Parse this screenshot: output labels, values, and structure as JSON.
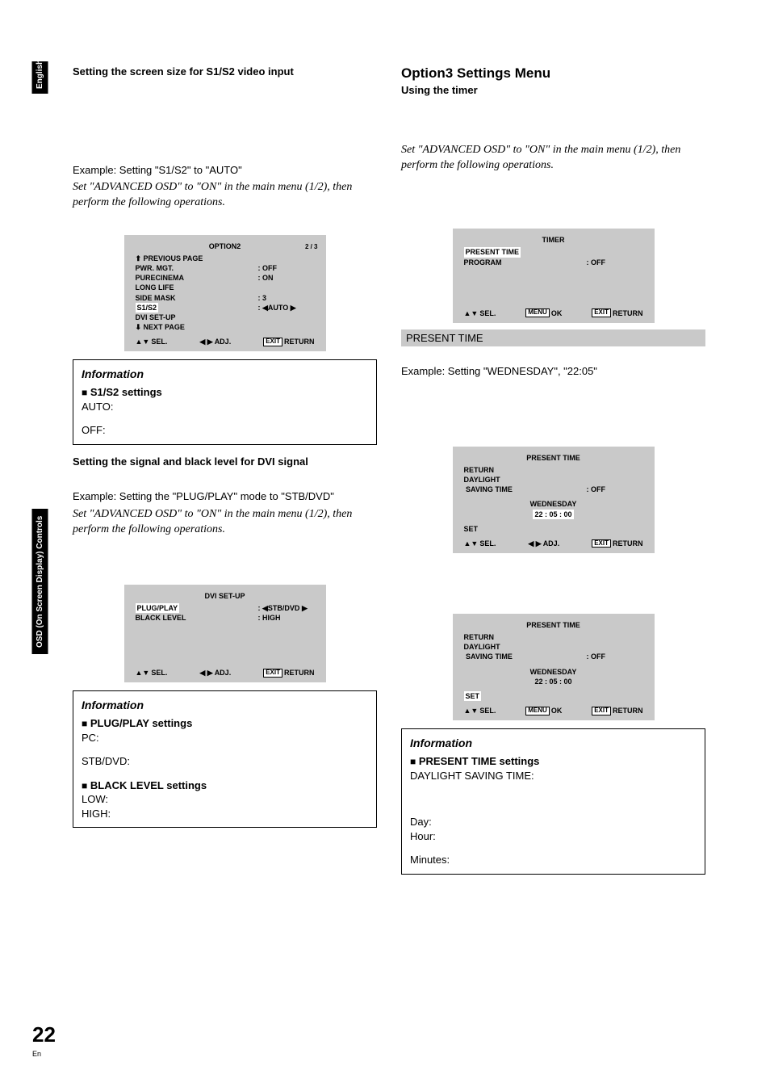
{
  "sidebar": {
    "lang": "English",
    "osd": "OSD (On Screen Display) Controls"
  },
  "page_number": "22",
  "page_lang": "En",
  "left": {
    "h1": "Setting the screen size for S1/S2 video input",
    "example1": "Example: Setting \"S1/S2\" to \"AUTO\"",
    "note1": "Set \"ADVANCED OSD\" to \"ON\" in the main menu (1/2), then perform the following operations.",
    "osd1": {
      "title": "OPTION2",
      "page": "2 / 3",
      "prev": "PREVIOUS PAGE",
      "rows": {
        "pwr": {
          "label": "PWR. MGT.",
          "val": ":   OFF"
        },
        "pure": {
          "label": "PURECINEMA",
          "val": ":   ON"
        },
        "long": {
          "label": "LONG LIFE",
          "val": ""
        },
        "side": {
          "label": "SIDE MASK",
          "val": ":   3"
        },
        "s1s2": {
          "label": "S1/S2",
          "val": "AUTO"
        },
        "dvi": {
          "label": "DVI SET-UP",
          "val": ""
        }
      },
      "next": "NEXT PAGE",
      "footer": {
        "sel": "SEL.",
        "adj": "ADJ.",
        "exit": "EXIT",
        "ret": "RETURN"
      }
    },
    "info1": {
      "title": "Information",
      "sub": "S1/S2 settings",
      "auto": "AUTO:",
      "off": "OFF:"
    },
    "h2": "Setting the signal and black level for DVI signal",
    "example2": "Example: Setting the \"PLUG/PLAY\" mode to \"STB/DVD\"",
    "note2": "Set \"ADVANCED OSD\" to \"ON\" in the main menu (1/2), then perform the following operations.",
    "osd2": {
      "title": "DVI SET-UP",
      "rows": {
        "plug": {
          "label": "PLUG/PLAY",
          "val": "STB/DVD"
        },
        "black": {
          "label": "BLACK LEVEL",
          "val": ":   HIGH"
        }
      },
      "footer": {
        "sel": "SEL.",
        "adj": "ADJ.",
        "exit": "EXIT",
        "ret": "RETURN"
      }
    },
    "info2": {
      "title": "Information",
      "sub1": "PLUG/PLAY settings",
      "pc": "PC:",
      "stb": "STB/DVD:",
      "sub2": "BLACK LEVEL settings",
      "low": "LOW:",
      "high": "HIGH:"
    }
  },
  "right": {
    "h_menu": "Option3 Settings Menu",
    "h_sub": "Using the timer",
    "note1": "Set \"ADVANCED OSD\" to \"ON\" in the main menu (1/2), then perform the following operations.",
    "osd1": {
      "title": "TIMER",
      "rows": {
        "present": {
          "label": "PRESENT TIME"
        },
        "program": {
          "label": "PROGRAM",
          "val": ":   OFF"
        }
      },
      "footer": {
        "sel": "SEL.",
        "menu": "MENU",
        "ok": "OK",
        "exit": "EXIT",
        "ret": "RETURN"
      }
    },
    "caption1": "PRESENT TIME",
    "example1": "Example: Setting \"WEDNESDAY\", \"22:05\"",
    "osd2": {
      "title": "PRESENT TIME",
      "return": "RETURN",
      "dl1": "DAYLIGHT",
      "dl2": "SAVING TIME",
      "dlval": ":   OFF",
      "day": "WEDNESDAY",
      "time": "22 : 05 : 00",
      "set": "SET",
      "footer": {
        "sel": "SEL.",
        "adj": "ADJ.",
        "exit": "EXIT",
        "ret": "RETURN"
      }
    },
    "osd3": {
      "title": "PRESENT TIME",
      "return": "RETURN",
      "dl1": "DAYLIGHT",
      "dl2": "SAVING TIME",
      "dlval": ":   OFF",
      "day": "WEDNESDAY",
      "time": "22 : 05 : 00",
      "set": "SET",
      "footer": {
        "sel": "SEL.",
        "menu": "MENU",
        "ok": "OK",
        "exit": "EXIT",
        "ret": "RETURN"
      }
    },
    "info1": {
      "title": "Information",
      "sub": "PRESENT TIME settings",
      "dst": "DAYLIGHT SAVING TIME:",
      "day": "Day:",
      "hour": "Hour:",
      "min": "Minutes:"
    }
  }
}
